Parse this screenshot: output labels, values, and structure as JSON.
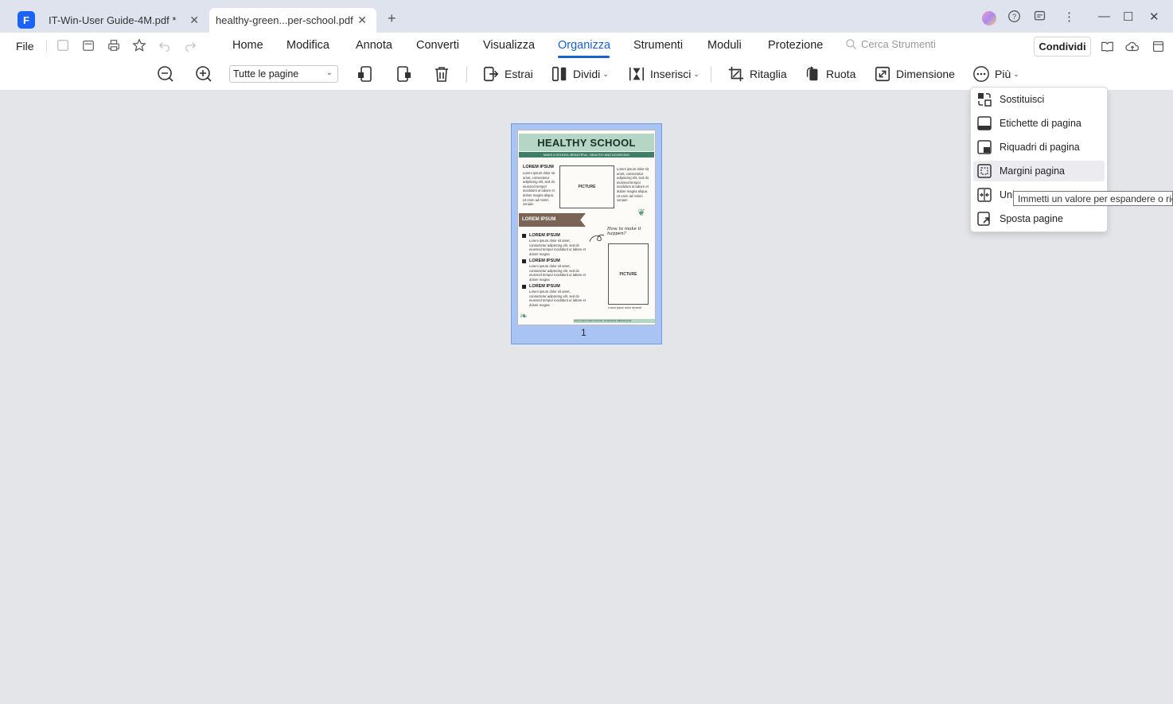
{
  "tabs": [
    {
      "label": "IT-Win-User Guide-4M.pdf *",
      "active": false
    },
    {
      "label": "healthy-green...per-school.pdf",
      "active": true
    }
  ],
  "menu": {
    "file": "File",
    "items": [
      "Home",
      "Modifica",
      "Annota",
      "Converti",
      "Visualizza",
      "Organizza",
      "Strumenti",
      "Moduli",
      "Protezione"
    ],
    "active": "Organizza",
    "search_placeholder": "Cerca Strumenti",
    "share": "Condividi"
  },
  "toolbar": {
    "page_select": "Tutte le pagine",
    "extract": "Estrai",
    "split": "Dividi",
    "insert": "Inserisci",
    "crop": "Ritaglia",
    "rotate": "Ruota",
    "size": "Dimensione",
    "more": "Più"
  },
  "dropdown": {
    "items": [
      "Sostituisci",
      "Etichette di pagina",
      "Riquadri di pagina",
      "Margini pagina",
      "Unisci",
      "Sposta pagine"
    ],
    "hovered": "Margini pagina",
    "visible_label_unisci": "Uni",
    "tooltip": "Immetti un valore per espandere o ridurre"
  },
  "thumbnail": {
    "page_number": "1",
    "title": "HEALTHY SCHOOL",
    "subtitle": "MAKE A SCHOOL BEAUTIFUL, HEALTHY AND ACHIEVING",
    "heading": "LOREM IPSUM",
    "banner": "LOREM IPSUM",
    "picture": "PICTURE",
    "body": "Lorem ipsum dolor sit amet, consectetur adipiscing elit, sed do eiusmod tempor incididunt ut labore et dolore magna aliqua. Ut enim ad minim veniam",
    "bullet_heading": "LOREM IPSUM",
    "bullet_text": "Lorem ipsum dolor sit amet, consectetur adipiscing elit, sed do eiusmod tempor incididunt ut labore et dolore magna",
    "handwriting": "How to make it happen?",
    "caption": "Lorem ipsum dolor sit amet",
    "footer": "Lorem ipsum dolor sit amet, consectetur adipiscing elit"
  },
  "colors": {
    "accent": "#1a5fd4",
    "thumb_selection": "#a9c4f3",
    "page_header": "#b5d6c4",
    "page_band": "#3f7e68",
    "banner": "#7a6456"
  }
}
